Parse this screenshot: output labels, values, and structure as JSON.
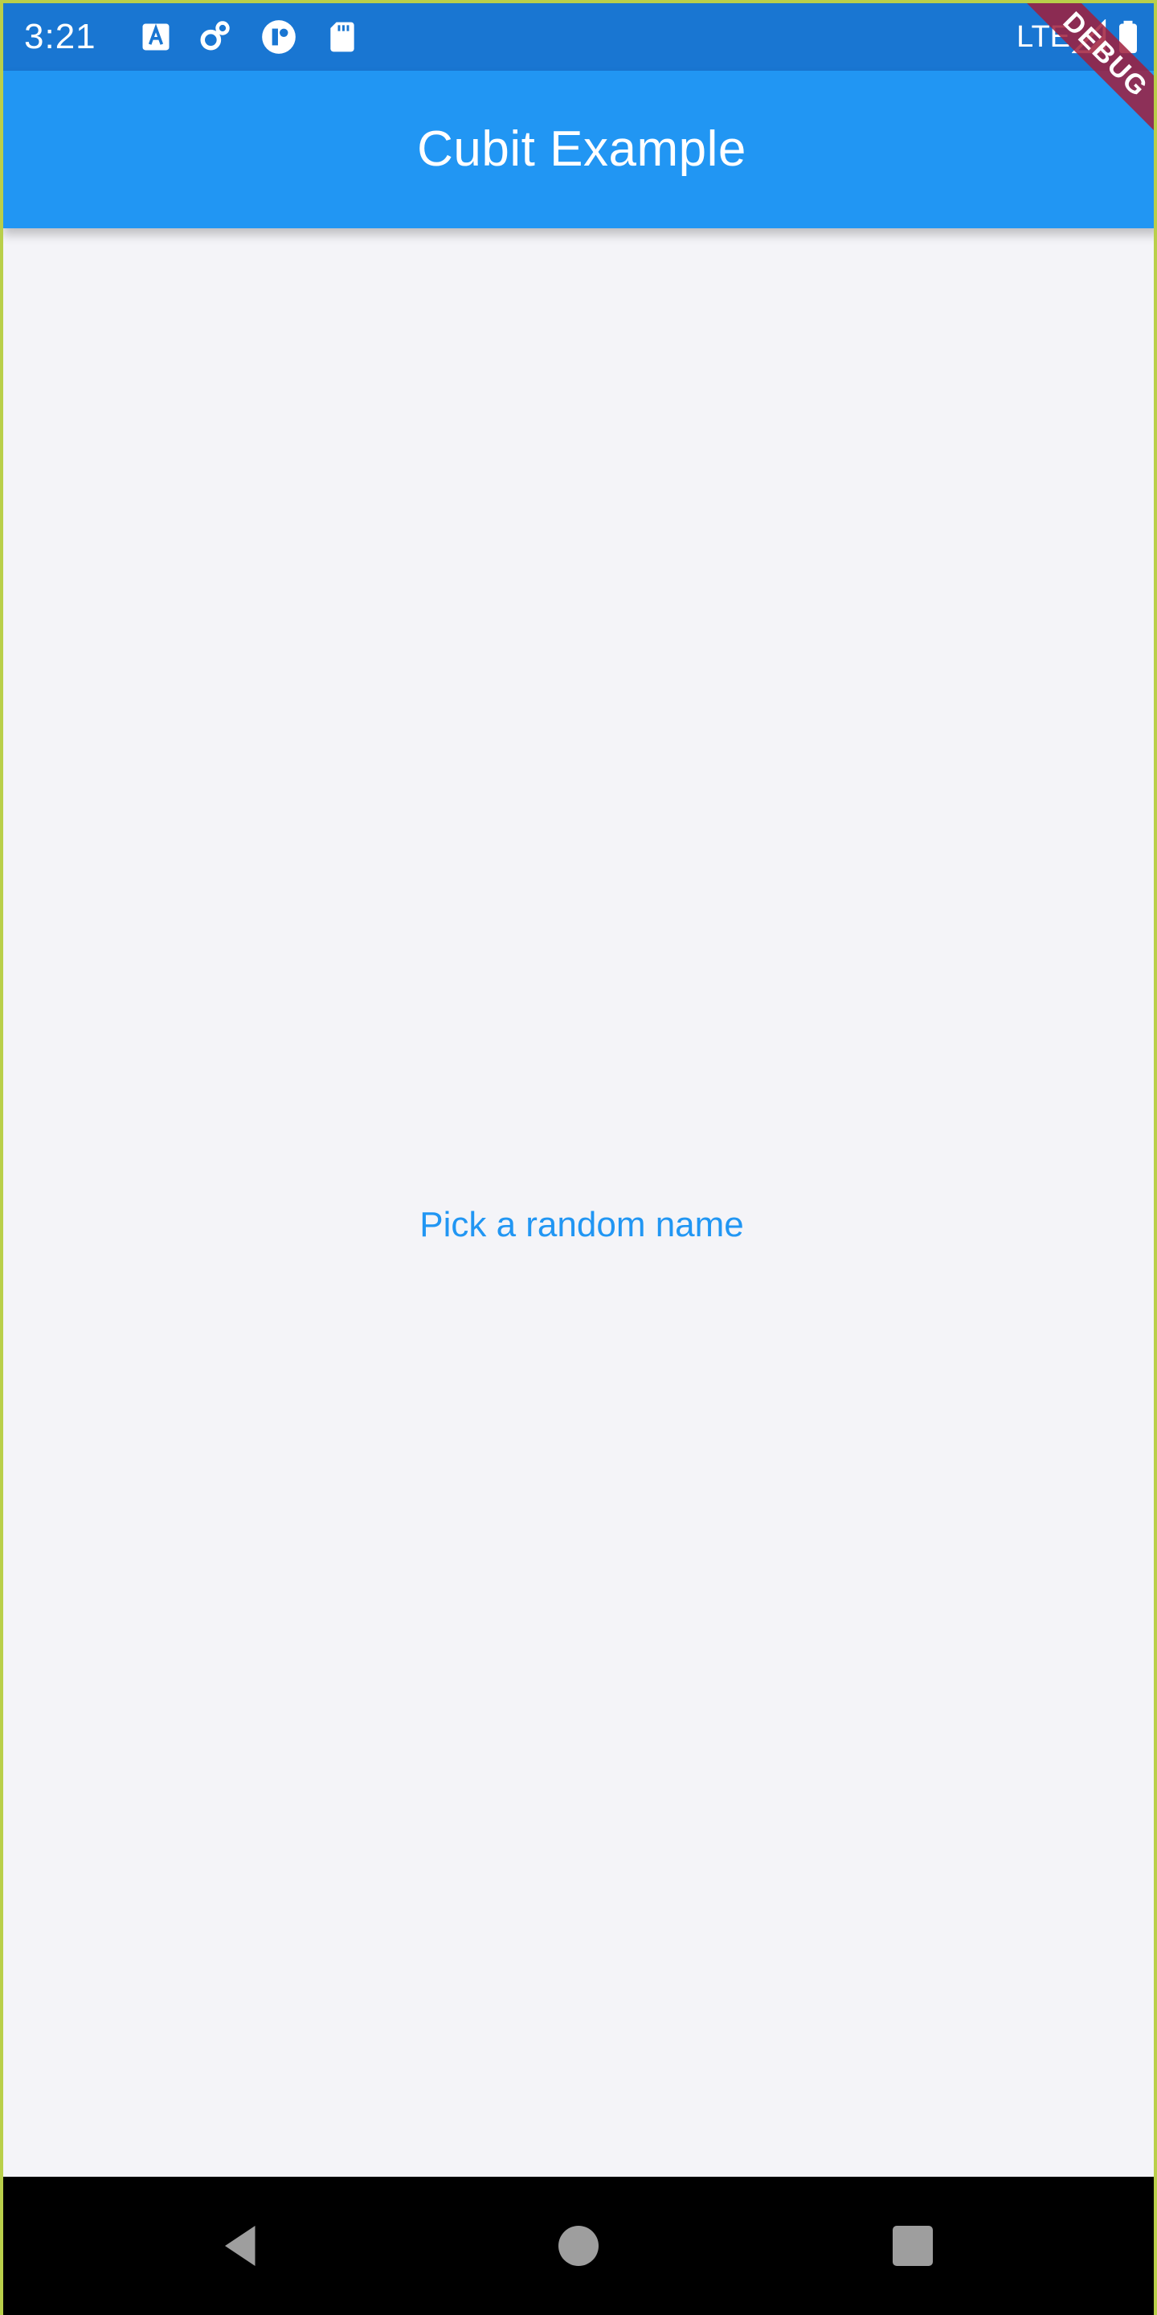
{
  "status_bar": {
    "time": "3:21",
    "network": "LTE",
    "icons": [
      "translate-icon",
      "settings-icon",
      "sync-icon",
      "sd-card-icon",
      "signal-icon",
      "battery-icon"
    ]
  },
  "app_bar": {
    "title": "Cubit Example"
  },
  "debug_banner": {
    "label": "DEBUG"
  },
  "main": {
    "button_label": "Pick a random name"
  },
  "nav_bar": {
    "icons": [
      "back-icon",
      "home-icon",
      "recents-icon"
    ]
  },
  "colors": {
    "status_bar": "#1976d2",
    "app_bar": "#2196f3",
    "accent_text": "#2196f3",
    "background": "#f4f4f8",
    "nav_bar": "#000000"
  }
}
